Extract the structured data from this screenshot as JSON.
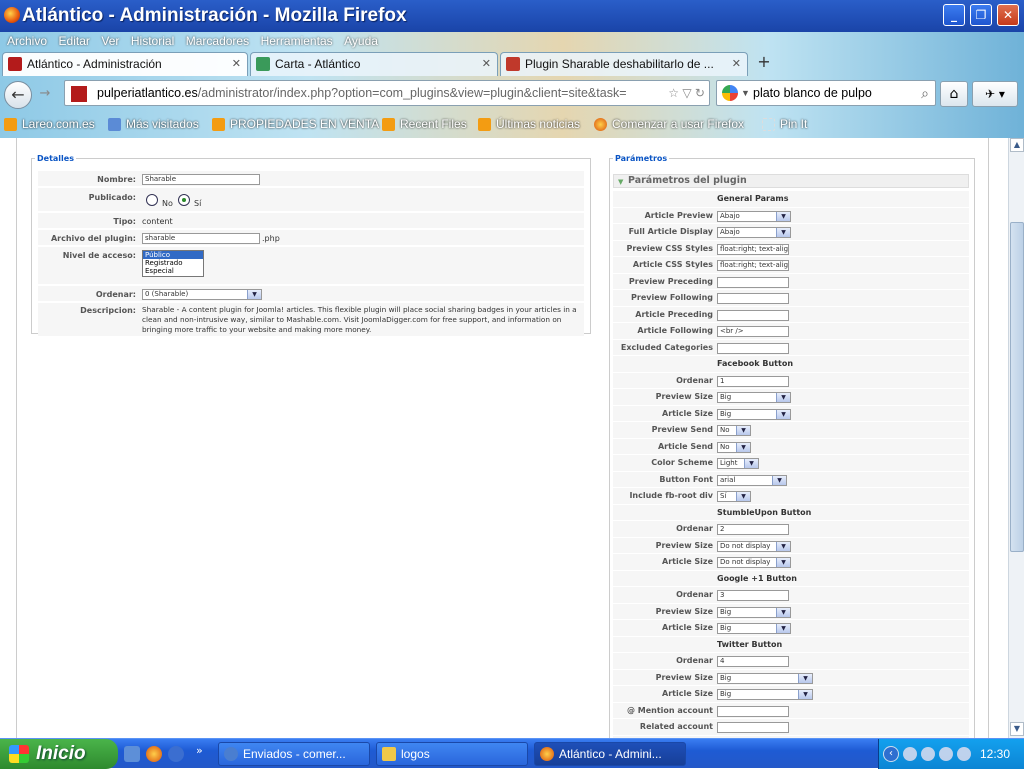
{
  "window": {
    "title": "Atlántico - Administración - Mozilla Firefox"
  },
  "menu": [
    "Archivo",
    "Editar",
    "Ver",
    "Historial",
    "Marcadores",
    "Herramientas",
    "Ayuda"
  ],
  "tabs": [
    {
      "label": "Atlántico - Administración",
      "active": true
    },
    {
      "label": "Carta - Atlántico",
      "active": false
    },
    {
      "label": "Plugin Sharable deshabilitarlo de ...",
      "active": false
    }
  ],
  "url": {
    "host": "pulperiatlantico.es",
    "path": "/administrator/index.php?option=com_plugins&view=plugin&client=site&task="
  },
  "search": {
    "value": "plato blanco de pulpo"
  },
  "bookmarks": [
    "Lareo.com.es",
    "Más visitados",
    "PROPIEDADES EN VENTA",
    "Recent Files",
    "Últimas noticias",
    "Comenzar a usar Firefox",
    "Pin It"
  ],
  "details": {
    "legend": "Detalles",
    "labels": {
      "nombre": "Nombre:",
      "publicado": "Publicado:",
      "tipo": "Tipo:",
      "archivo": "Archivo del plugin:",
      "nivel": "Nivel de acceso:",
      "ordenar": "Ordenar:",
      "descripcion": "Descripcion:"
    },
    "nombre": "Sharable",
    "publicado_no": "No",
    "publicado_si": "Sí",
    "tipo": "content",
    "archivo": "sharable",
    "archivo_ext": ".php",
    "nivel_options": [
      "Público",
      "Registrado",
      "Especial"
    ],
    "ordenar": "0 (Sharable)",
    "descripcion": "Sharable - A content plugin for Joomla! articles. This flexible plugin will place social sharing badges in your articles in a clean and non-intrusive way, similar to Mashable.com. Visit JoomlaDigger.com for free support, and information on bringing more traffic to your website and making more money."
  },
  "params": {
    "legend": "Parámetros",
    "panel_title": "Parámetros del plugin",
    "rows": [
      {
        "label": "",
        "heading": "General Params"
      },
      {
        "label": "Article Preview Display",
        "type": "select",
        "value": "Abajo"
      },
      {
        "label": "Full Article Display",
        "type": "select",
        "value": "Abajo"
      },
      {
        "label": "Preview CSS Styles",
        "type": "input",
        "value": "float:right; text-align:r"
      },
      {
        "label": "Article CSS Styles",
        "type": "input",
        "value": "float:right; text-align:r"
      },
      {
        "label": "Preview Preceding HTML",
        "type": "input",
        "value": ""
      },
      {
        "label": "Preview Following HTML",
        "type": "input",
        "value": ""
      },
      {
        "label": "Article Preceding HTML",
        "type": "input",
        "value": ""
      },
      {
        "label": "Article Following HTML",
        "type": "input",
        "value": "<br />"
      },
      {
        "label": "Excluded Categories",
        "type": "input",
        "value": ""
      },
      {
        "label": "",
        "heading": "Facebook Button"
      },
      {
        "label": "Ordenar",
        "type": "input",
        "value": "1"
      },
      {
        "label": "Preview Size",
        "type": "select",
        "value": "Big"
      },
      {
        "label": "Article Size",
        "type": "select",
        "value": "Big"
      },
      {
        "label": "Preview Send",
        "type": "selectsm",
        "value": "No"
      },
      {
        "label": "Article Send",
        "type": "selectsm",
        "value": "No"
      },
      {
        "label": "Color Scheme",
        "type": "selectmd",
        "value": "Light"
      },
      {
        "label": "Button Font",
        "type": "selectlg",
        "value": "arial"
      },
      {
        "label": "Include fb-root div",
        "type": "selectsm",
        "value": "Sí"
      },
      {
        "label": "",
        "heading": "StumbleUpon Button"
      },
      {
        "label": "Ordenar",
        "type": "input",
        "value": "2"
      },
      {
        "label": "Preview Size",
        "type": "select",
        "value": "Do not display"
      },
      {
        "label": "Article Size",
        "type": "select",
        "value": "Do not display"
      },
      {
        "label": "",
        "heading": "Google +1 Button"
      },
      {
        "label": "Ordenar",
        "type": "input",
        "value": "3"
      },
      {
        "label": "Preview Size",
        "type": "select",
        "value": "Big"
      },
      {
        "label": "Article Size",
        "type": "select",
        "value": "Big"
      },
      {
        "label": "",
        "heading": "Twitter Button"
      },
      {
        "label": "Ordenar",
        "type": "input",
        "value": "4"
      },
      {
        "label": "Preview Size",
        "type": "selectxl",
        "value": "Big"
      },
      {
        "label": "Article Size",
        "type": "selectxl",
        "value": "Big"
      },
      {
        "label": "@ Mention account",
        "type": "input",
        "value": ""
      },
      {
        "label": "Related account",
        "type": "input",
        "value": ""
      },
      {
        "label": "Related account",
        "type": "input",
        "value": ""
      }
    ]
  },
  "taskbar": {
    "start": "Inicio",
    "tasks": [
      {
        "label": "Enviados - comer...",
        "active": false
      },
      {
        "label": "logos",
        "active": false
      },
      {
        "label": "Atlántico - Admini...",
        "active": true
      }
    ],
    "clock": "12:30"
  }
}
